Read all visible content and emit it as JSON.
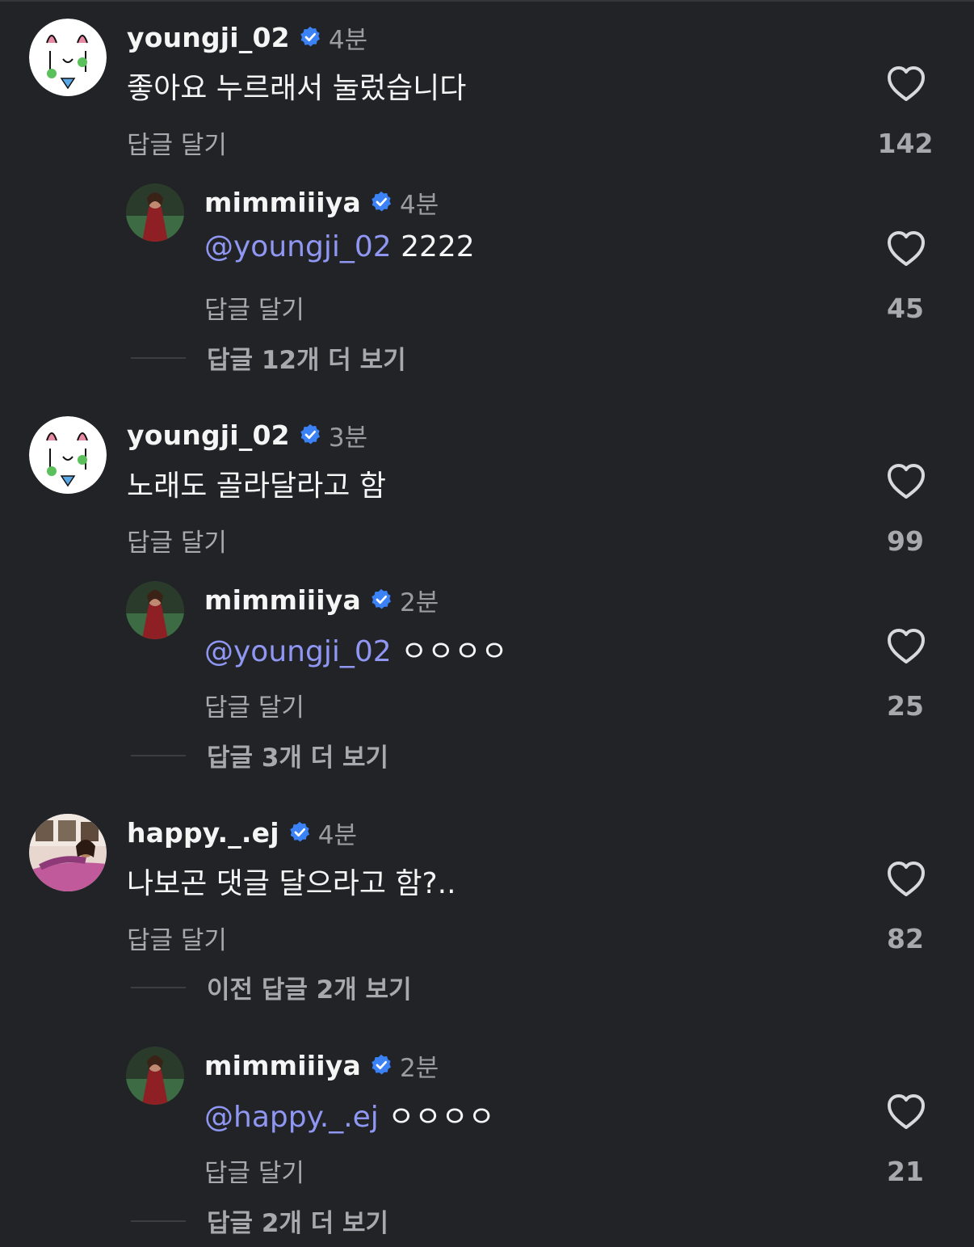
{
  "comments": [
    {
      "username": "youngji_02",
      "time": "4분",
      "text": "좋아요 누르래서 눌렀습니다",
      "reply_label": "답글 달기",
      "likes": "142",
      "replies": [
        {
          "username": "mimmiiiya",
          "time": "4분",
          "mention": "@youngji_02",
          "text": "2222",
          "reply_label": "답글 달기",
          "likes": "45"
        }
      ],
      "more_label": "답글 12개 더 보기"
    },
    {
      "username": "youngji_02",
      "time": "3분",
      "text": "노래도 골라달라고 함",
      "reply_label": "답글 달기",
      "likes": "99",
      "replies": [
        {
          "username": "mimmiiiya",
          "time": "2분",
          "mention": "@youngji_02",
          "text": "ㅇㅇㅇㅇ",
          "reply_label": "답글 달기",
          "likes": "25"
        }
      ],
      "more_label": "답글 3개 더 보기"
    },
    {
      "username": "happy._.ej",
      "time": "4분",
      "text": "나보곤 댓글 달으라고 함?..",
      "reply_label": "답글 달기",
      "likes": "82",
      "previous_label": "이전 답글 2개 보기",
      "replies": [
        {
          "username": "mimmiiiya",
          "time": "2분",
          "mention": "@happy._.ej",
          "text": "ㅇㅇㅇㅇ",
          "reply_label": "답글 달기",
          "likes": "21"
        }
      ],
      "more_label": "답글 2개 더 보기"
    }
  ],
  "colors": {
    "background": "#212327",
    "mention": "#8f97f2",
    "verified": "#3b82f6",
    "muted": "#a7a9ae"
  },
  "icons": {
    "like": "heart-outline-icon",
    "verified": "verified-badge-icon"
  }
}
